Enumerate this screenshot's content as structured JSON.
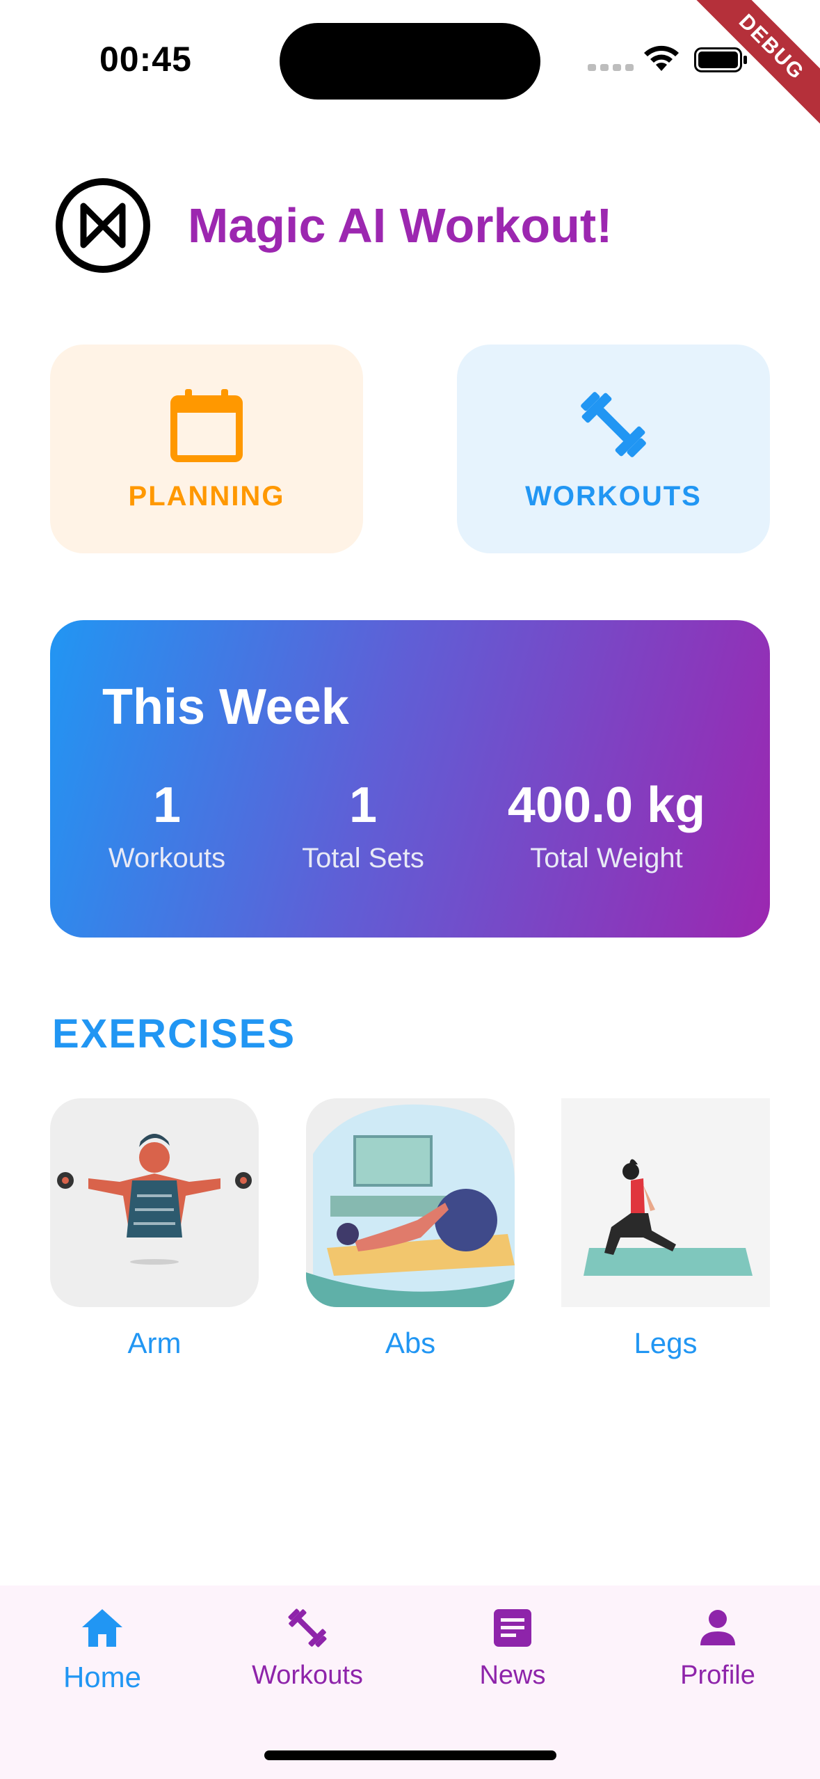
{
  "status_bar": {
    "time": "00:45",
    "debug": "DEBUG"
  },
  "header": {
    "title": "Magic AI Workout!",
    "logo_icon": "magic-logo-icon"
  },
  "quick_actions": [
    {
      "label": "PLANNING",
      "icon": "calendar-icon",
      "color": "#ff9800",
      "background": "#fff3e6"
    },
    {
      "label": "WORKOUTS",
      "icon": "dumbbell-icon",
      "color": "#2196f3",
      "background": "#e6f3fd"
    }
  ],
  "week": {
    "title": "This Week",
    "stats": [
      {
        "value": "1",
        "label": "Workouts"
      },
      {
        "value": "1",
        "label": "Total Sets"
      },
      {
        "value": "400.0 kg",
        "label": "Total Weight"
      }
    ],
    "gradient": [
      "#2196f3",
      "#9c27b0"
    ]
  },
  "exercises": {
    "title": "EXERCISES",
    "items": [
      {
        "label": "Arm",
        "image": "arm-illustration"
      },
      {
        "label": "Abs",
        "image": "abs-illustration"
      },
      {
        "label": "Legs",
        "image": "legs-illustration"
      }
    ]
  },
  "bottom_nav": {
    "items": [
      {
        "label": "Home",
        "icon": "home-icon",
        "active": true
      },
      {
        "label": "Workouts",
        "icon": "dumbbell-icon",
        "active": false
      },
      {
        "label": "News",
        "icon": "article-icon",
        "active": false
      },
      {
        "label": "Profile",
        "icon": "person-icon",
        "active": false
      }
    ],
    "active_color": "#2196f3",
    "inactive_color": "#8e24aa"
  }
}
